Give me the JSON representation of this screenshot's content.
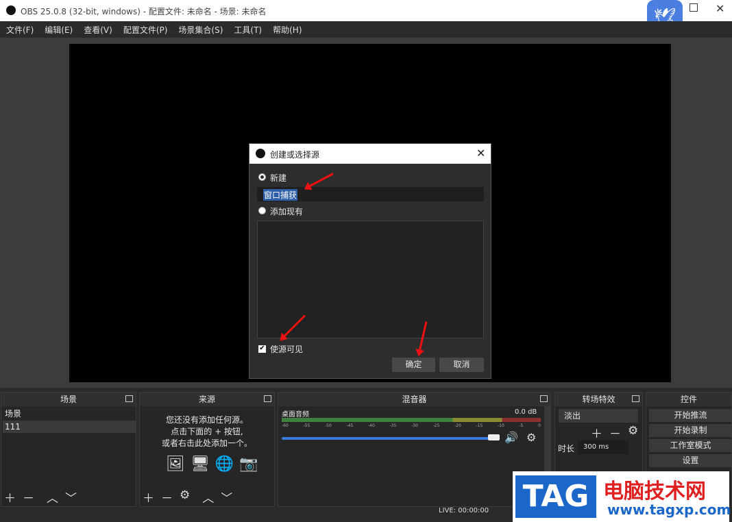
{
  "window": {
    "title": "OBS 25.0.8 (32-bit, windows) - 配置文件: 未命名 - 场景: 未命名"
  },
  "menu": [
    "文件(F)",
    "编辑(E)",
    "查看(V)",
    "配置文件(P)",
    "场景集合(S)",
    "工具(T)",
    "帮助(H)"
  ],
  "dialog": {
    "title": "创建或选择源",
    "new_label": "新建",
    "name_value": "窗口捕获",
    "existing_label": "添加现有",
    "visible_label": "使源可见",
    "ok": "确定",
    "cancel": "取消"
  },
  "docks": {
    "scenes": {
      "title": "场景",
      "items": [
        "场景",
        "111"
      ]
    },
    "sources": {
      "title": "来源",
      "empty_lines": [
        "您还没有添加任何源。",
        "点击下面的 + 按钮,",
        "或者右击此处添加一个。"
      ]
    },
    "mixer": {
      "title": "混音器",
      "channel": "桌面音频",
      "db": "0.0 dB",
      "ticks": [
        "-60",
        "-55",
        "-50",
        "-45",
        "-40",
        "-35",
        "-30",
        "-25",
        "-20",
        "-15",
        "-10",
        "-5",
        "0"
      ]
    },
    "transitions": {
      "title": "转场特效",
      "selected": "淡出",
      "duration_label": "时长",
      "duration_value": "300 ms"
    },
    "controls": {
      "title": "控件",
      "buttons": [
        "开始推流",
        "开始录制",
        "工作室模式",
        "设置"
      ]
    }
  },
  "status": {
    "live": "LIVE: 00:00:00"
  },
  "watermark": {
    "tag": "TAG",
    "site_name": "电脑技术网",
    "url": "www.tagxp.com"
  }
}
